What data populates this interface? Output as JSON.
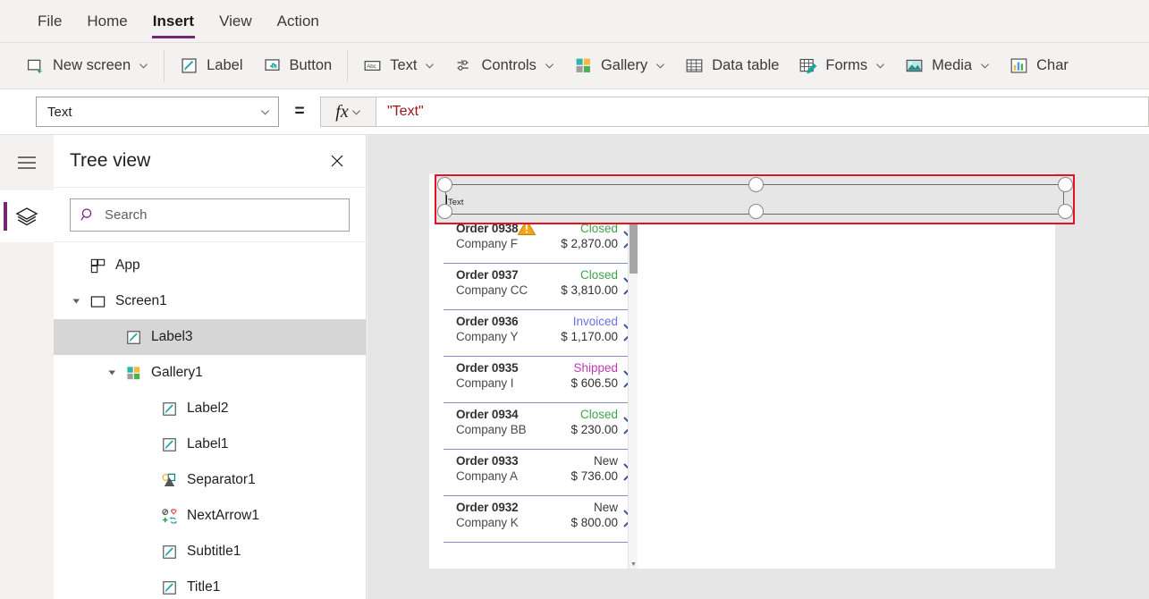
{
  "menu": {
    "tabs": [
      {
        "label": "File",
        "active": false
      },
      {
        "label": "Home",
        "active": false
      },
      {
        "label": "Insert",
        "active": true
      },
      {
        "label": "View",
        "active": false
      },
      {
        "label": "Action",
        "active": false
      }
    ],
    "accent_color": "#742774"
  },
  "ribbon": {
    "items": [
      {
        "label": "New screen",
        "icon": "new-screen-icon",
        "caret": true
      },
      {
        "label": "Label",
        "icon": "label-icon",
        "caret": false
      },
      {
        "label": "Button",
        "icon": "button-icon",
        "caret": false
      },
      {
        "label": "Text",
        "icon": "text-icon",
        "caret": true
      },
      {
        "label": "Controls",
        "icon": "controls-icon",
        "caret": true
      },
      {
        "label": "Gallery",
        "icon": "gallery-icon",
        "caret": true
      },
      {
        "label": "Data table",
        "icon": "data-table-icon",
        "caret": false
      },
      {
        "label": "Forms",
        "icon": "forms-icon",
        "caret": true
      },
      {
        "label": "Media",
        "icon": "media-icon",
        "caret": true
      },
      {
        "label": "Char",
        "icon": "charts-icon",
        "caret": false
      }
    ]
  },
  "formula_bar": {
    "property": "Text",
    "equals": "=",
    "fx_label": "fx",
    "formula": "\"Text\"",
    "formula_color": "#a31515"
  },
  "tree_view": {
    "title": "Tree view",
    "search_placeholder": "Search",
    "search_value": "",
    "items": [
      {
        "label": "App",
        "icon": "app-icon",
        "indent": 0,
        "twisty": "none",
        "selected": false
      },
      {
        "label": "Screen1",
        "icon": "screen-icon",
        "indent": 0,
        "twisty": "expanded",
        "selected": false
      },
      {
        "label": "Label3",
        "icon": "label-icon",
        "indent": 1,
        "twisty": "none",
        "selected": true
      },
      {
        "label": "Gallery1",
        "icon": "gallery-icon",
        "indent": 1,
        "twisty": "expanded",
        "selected": false
      },
      {
        "label": "Label2",
        "icon": "label-icon",
        "indent": 2,
        "twisty": "none",
        "selected": false
      },
      {
        "label": "Label1",
        "icon": "label-icon",
        "indent": 2,
        "twisty": "none",
        "selected": false
      },
      {
        "label": "Separator1",
        "icon": "shapes-icon",
        "indent": 2,
        "twisty": "none",
        "selected": false
      },
      {
        "label": "NextArrow1",
        "icon": "icons-icon",
        "indent": 2,
        "twisty": "none",
        "selected": false
      },
      {
        "label": "Subtitle1",
        "icon": "label-icon",
        "indent": 2,
        "twisty": "none",
        "selected": false
      },
      {
        "label": "Title1",
        "icon": "label-icon",
        "indent": 2,
        "twisty": "none",
        "selected": false
      }
    ]
  },
  "canvas": {
    "selected_control": {
      "text": "Text",
      "selection_color": "#e81123",
      "handle_count": 6
    },
    "gallery": {
      "status_colors": {
        "Closed": "#3fa34d",
        "Invoiced": "#6b6ff0",
        "Shipped": "#c239b3",
        "New": "#3b3a39"
      },
      "rows": [
        {
          "order": "Order 0938",
          "company": "Company F",
          "status": "Closed",
          "amount": "$ 2,870.00",
          "warning": true
        },
        {
          "order": "Order 0937",
          "company": "Company CC",
          "status": "Closed",
          "amount": "$ 3,810.00",
          "warning": false
        },
        {
          "order": "Order 0936",
          "company": "Company Y",
          "status": "Invoiced",
          "amount": "$ 1,170.00",
          "warning": false
        },
        {
          "order": "Order 0935",
          "company": "Company I",
          "status": "Shipped",
          "amount": "$ 606.50",
          "warning": false
        },
        {
          "order": "Order 0934",
          "company": "Company BB",
          "status": "Closed",
          "amount": "$ 230.00",
          "warning": false
        },
        {
          "order": "Order 0933",
          "company": "Company A",
          "status": "New",
          "amount": "$ 736.00",
          "warning": false
        },
        {
          "order": "Order 0932",
          "company": "Company K",
          "status": "New",
          "amount": "$ 800.00",
          "warning": false
        }
      ]
    }
  }
}
